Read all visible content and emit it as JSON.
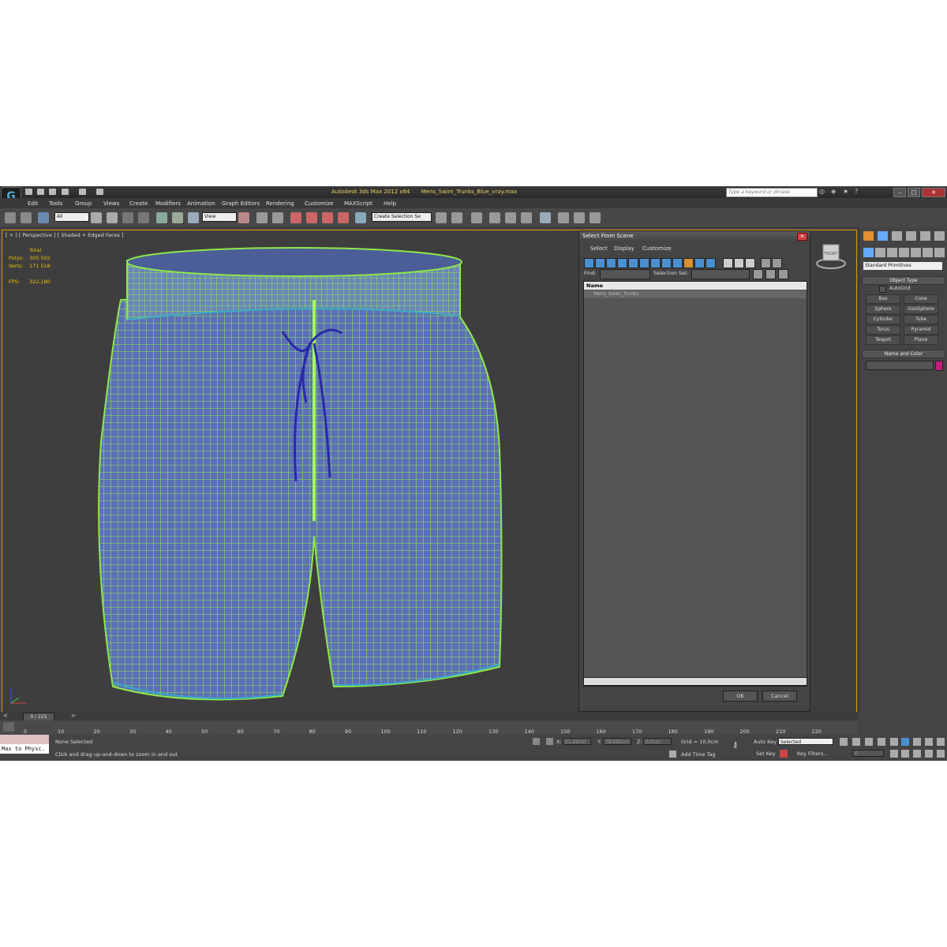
{
  "window": {
    "app_name": "Autodesk 3ds Max  2012 x64",
    "file_name": "Mens_Swim_Trunks_Blue_vray.max",
    "search_placeholder": "Type a keyword or phrase"
  },
  "menu": [
    "Edit",
    "Tools",
    "Group",
    "Views",
    "Create",
    "Modifiers",
    "Animation",
    "Graph Editors",
    "Rendering",
    "Customize",
    "MAXScript",
    "Help"
  ],
  "toolbar": {
    "filter_value": "All",
    "coord_value": "View",
    "selection_set_value": "Create Selection Se"
  },
  "viewport": {
    "label": "[ + ] [ Perspective ] [ Shaded + Edged Faces ]",
    "stats_header": "Total",
    "stats": [
      {
        "key": "Polys:",
        "value": "305 502"
      },
      {
        "key": "Verts:",
        "value": "171 518"
      }
    ],
    "fps_label": "FPS:",
    "fps_value": "322,180",
    "viewcube_label": "FRONT"
  },
  "dialog": {
    "title": "Select From Scene",
    "menu": [
      "Select",
      "Display",
      "Customize"
    ],
    "find_label": "Find:",
    "selection_set_label": "Selection Set:",
    "column_header": "Name",
    "rows": [
      "Mens_Swim_Trunks"
    ],
    "ok_label": "OK",
    "cancel_label": "Cancel"
  },
  "command_panel": {
    "dropdown_value": "Standard Primitives",
    "object_type_header": "Object Type",
    "autogrid_label": "AutoGrid",
    "buttons": [
      "Box",
      "Cone",
      "Sphere",
      "GeoSphere",
      "Cylinder",
      "Tube",
      "Torus",
      "Pyramid",
      "Teapot",
      "Plane"
    ],
    "name_color_header": "Name and Color",
    "color_swatch": "#c0207a"
  },
  "timeline": {
    "slider_label": "0 / 225",
    "ticks": [
      "10",
      "20",
      "30",
      "40",
      "50",
      "60",
      "70",
      "80",
      "90",
      "100",
      "110",
      "120",
      "130",
      "140",
      "150",
      "160",
      "170",
      "180",
      "190",
      "200",
      "210",
      "220"
    ],
    "tick_zero": "0"
  },
  "statusbar": {
    "maxscript_text": "Max to Physc.",
    "selection_status": "None Selected",
    "prompt": "Click and drag up-and-down to zoom in and out",
    "x_label": "X:",
    "x_value": "51,69cm",
    "y_label": "Y:",
    "y_value": "78,582cm",
    "z_label": "Z:",
    "z_value": "0,0cm",
    "grid_label": "Grid = 10,0cm",
    "add_time_tag": "Add Time Tag",
    "auto_key": "Auto Key",
    "selected_value": "Selected",
    "set_key": "Set Key",
    "key_filters": "Key Filters...",
    "frame_value": "0"
  },
  "colors": {
    "wire_green": "#8fe84a",
    "mesh_blue": "#5c6fb8",
    "drawstring": "#2a2aa8",
    "viewport_border": "#d6a000",
    "stats_text": "#e8c000"
  }
}
